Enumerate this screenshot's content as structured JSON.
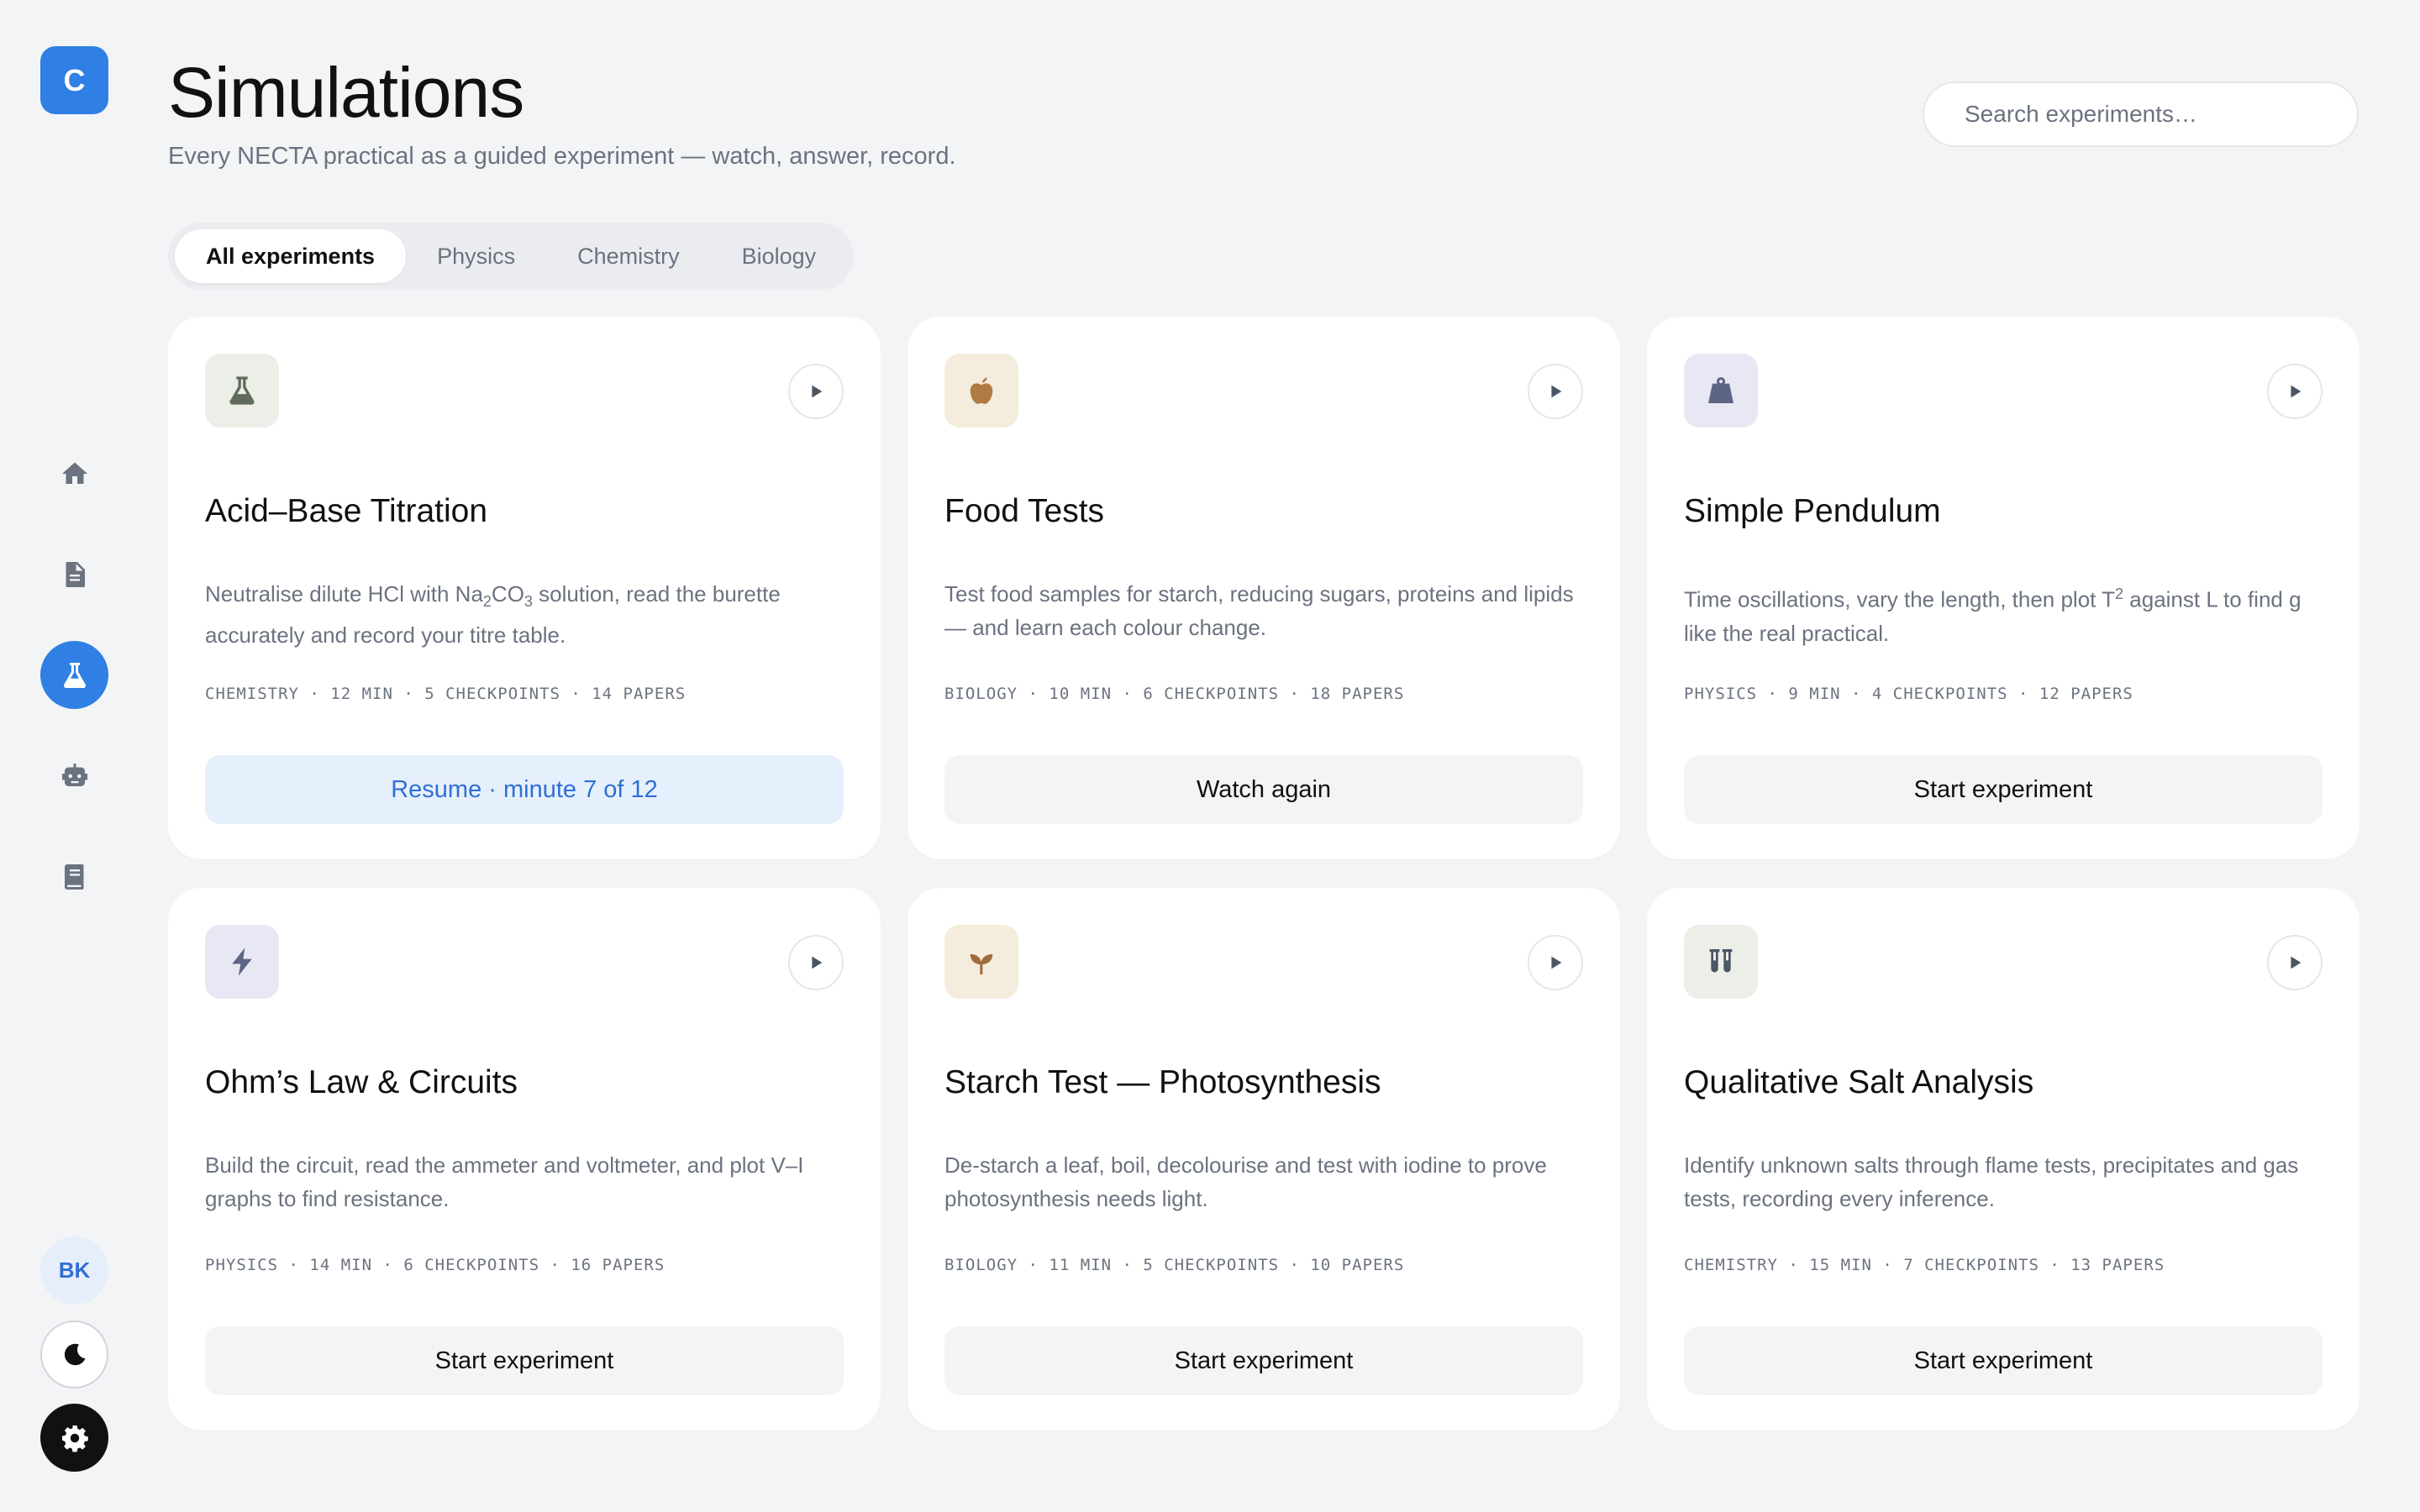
{
  "app": {
    "logo_letter": "C"
  },
  "sidebar": {
    "items": [
      {
        "name": "home",
        "icon": "home-icon"
      },
      {
        "name": "documents",
        "icon": "document-icon"
      },
      {
        "name": "simulations",
        "icon": "flask-icon",
        "active": true
      },
      {
        "name": "assistant",
        "icon": "robot-icon"
      },
      {
        "name": "library",
        "icon": "book-icon"
      }
    ],
    "avatar_initials": "BK"
  },
  "header": {
    "title": "Simulations",
    "subtitle": "Every NECTA practical as a guided experiment — watch, answer, record."
  },
  "search": {
    "placeholder": "Search experiments…",
    "value": ""
  },
  "tabs": [
    {
      "label": "All experiments",
      "active": true
    },
    {
      "label": "Physics"
    },
    {
      "label": "Chemistry"
    },
    {
      "label": "Biology"
    }
  ],
  "cards": [
    {
      "title": "Acid–Base Titration",
      "desc_before": "Neutralise dilute HCl with Na",
      "desc_sub1": "2",
      "desc_mid": "CO",
      "desc_sub2": "3",
      "desc_after": " solution, read the burette accurately and record your titre table.",
      "meta": "CHEMISTRY · 12 MIN · 5 CHECKPOINTS · 14 PAPERS",
      "button": "Resume · minute 7 of 12",
      "icon": "flask-icon",
      "icon_bg": "#eceee8",
      "icon_color": "#5f6b5b"
    },
    {
      "title": "Food Tests",
      "desc": "Test food samples for starch, reducing sugars, proteins and lipids — and learn each colour change.",
      "meta": "BIOLOGY · 10 MIN · 6 CHECKPOINTS · 18 PAPERS",
      "button": "Watch again",
      "icon": "apple-icon",
      "icon_bg": "#f4ecdc",
      "icon_color": "#b07a44"
    },
    {
      "title": "Simple Pendulum",
      "desc_before": "Time oscillations, vary the length, then plot T",
      "desc_sup": "2",
      "desc_after": " against L to find g like the real practical.",
      "meta": "PHYSICS · 9 MIN · 4 CHECKPOINTS · 12 PAPERS",
      "button": "Start experiment",
      "icon": "weight-icon",
      "icon_bg": "#e8e8f4",
      "icon_color": "#5c6584"
    },
    {
      "title": "Ohm’s Law & Circuits",
      "desc": "Build the circuit, read the ammeter and voltmeter, and plot V–I graphs to find resistance.",
      "meta": "PHYSICS · 14 MIN · 6 CHECKPOINTS · 16 PAPERS",
      "button": "Start experiment",
      "icon": "bolt-icon",
      "icon_bg": "#e8e8f4",
      "icon_color": "#5c6584"
    },
    {
      "title": "Starch Test — Photosynthesis",
      "desc": "De-starch a leaf, boil, decolourise and test with iodine to prove photosynthesis needs light.",
      "meta": "BIOLOGY · 11 MIN · 5 CHECKPOINTS · 10 PAPERS",
      "button": "Start experiment",
      "icon": "sprout-icon",
      "icon_bg": "#f4ecdc",
      "icon_color": "#a06a3a"
    },
    {
      "title": "Qualitative Salt Analysis",
      "desc": "Identify unknown salts through flame tests, precipitates and gas tests, recording every inference.",
      "meta": "CHEMISTRY · 15 MIN · 7 CHECKPOINTS · 13 PAPERS",
      "button": "Start experiment",
      "icon": "test-tubes-icon",
      "icon_bg": "#eceee8",
      "icon_color": "#4b5563"
    }
  ],
  "colors": {
    "accent": "#2f7fe4",
    "background": "#f3f4f6",
    "resume_bg": "#e6f0fc",
    "resume_text": "#2f6fd6"
  }
}
